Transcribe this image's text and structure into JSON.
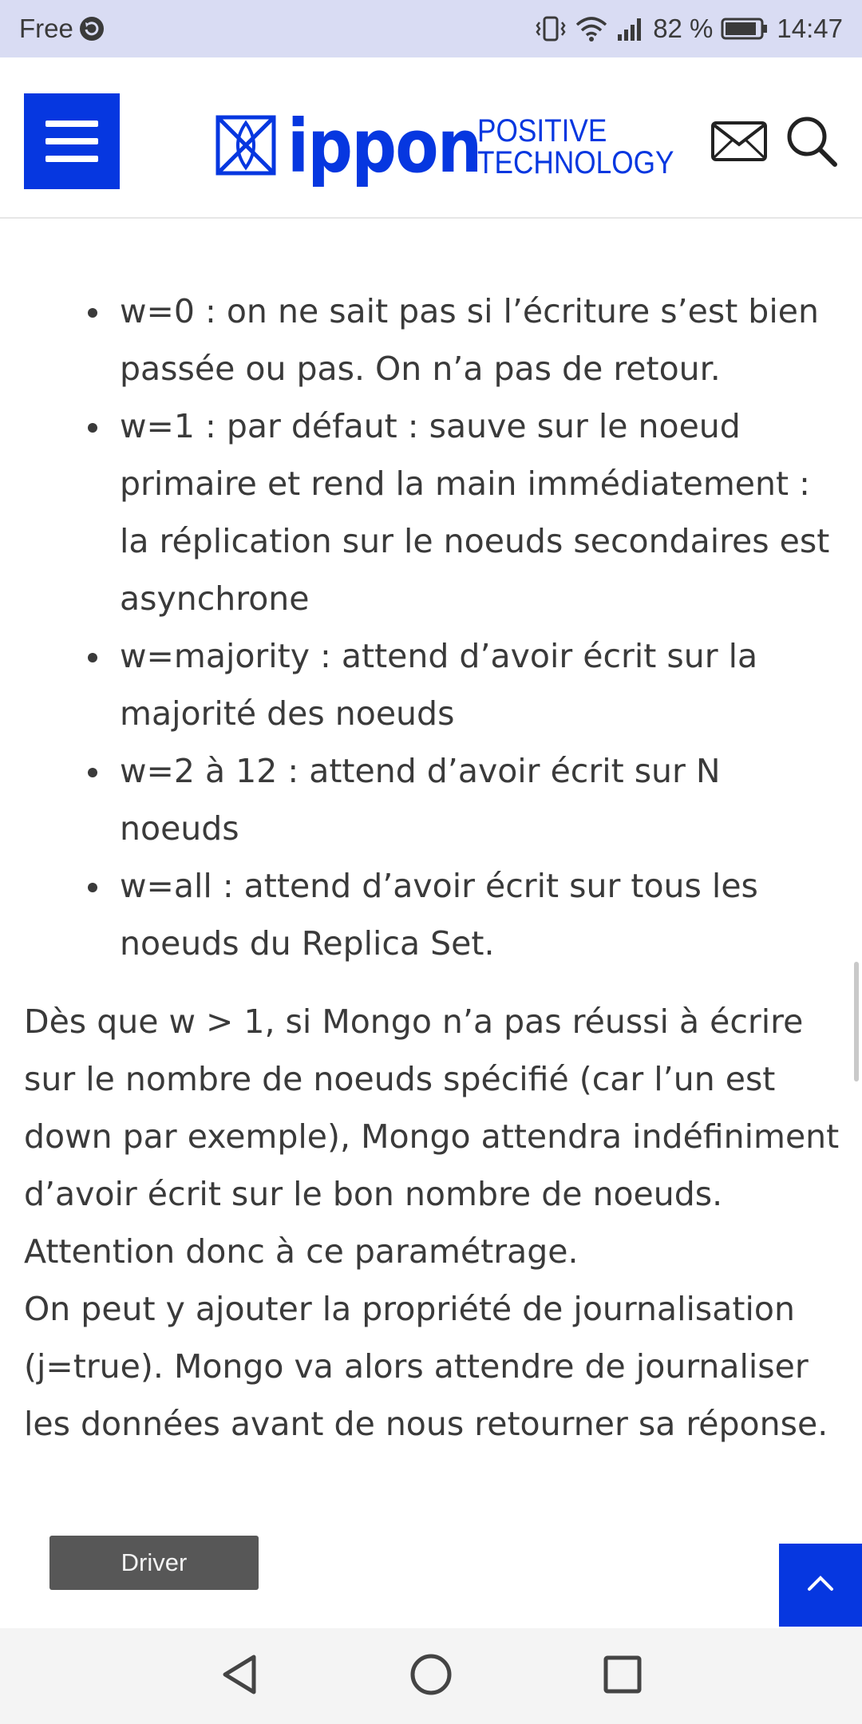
{
  "status_bar": {
    "carrier": "Free",
    "battery_percent": "82 %",
    "time": "14:47",
    "icons": [
      "carrier-sync-icon",
      "vibrate-icon",
      "wifi-icon",
      "signal-icon",
      "battery-icon"
    ]
  },
  "header": {
    "logo_word": "ippon",
    "logo_tagline_line1": "POSITIVE",
    "logo_tagline_line2": "TECHNOLOGY",
    "icons": [
      "menu-icon",
      "mail-icon",
      "search-icon"
    ],
    "brand_color": "#0637e0"
  },
  "article": {
    "bullets": [
      "w=0 : on ne sait pas si l’écriture s’est bien passée ou pas. On n’a pas de retour.",
      "w=1 : par défaut : sauve sur le noeud primaire et rend la main immédiatement : la réplication sur le noeuds secondaires est asynchrone",
      "w=majority : attend d’avoir écrit sur la majorité des noeuds",
      "w=2 à 12 : attend d’avoir écrit sur N noeuds",
      "w=all : attend d’avoir écrit sur tous les noeuds du Replica Set."
    ],
    "paragraph_1": "Dès que w > 1, si Mongo n’a pas réussi à écrire sur le nombre de noeuds spécifié (car l’un est down par exemple), Mongo attendra indéfiniment d’avoir écrit sur le bon nombre de noeuds. Attention donc à ce paramétrage.",
    "paragraph_2": "On peut y ajouter la propriété de journalisation (j=true). Mongo va alors attendre de journaliser les données avant de nous retourner sa réponse."
  },
  "diagram": {
    "driver_label": "Driver"
  },
  "scroll_top": {
    "icon": "chevron-up-icon"
  },
  "nav_bar": {
    "icons": [
      "back-icon",
      "home-icon",
      "recents-icon"
    ]
  }
}
